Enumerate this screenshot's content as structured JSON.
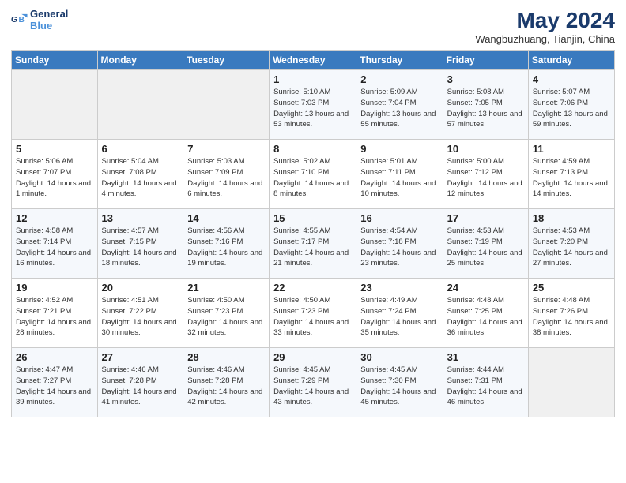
{
  "header": {
    "monthYear": "May 2024",
    "location": "Wangbuzhuang, Tianjin, China"
  },
  "calendar": {
    "headers": [
      "Sunday",
      "Monday",
      "Tuesday",
      "Wednesday",
      "Thursday",
      "Friday",
      "Saturday"
    ],
    "weeks": [
      [
        {
          "day": "",
          "info": ""
        },
        {
          "day": "",
          "info": ""
        },
        {
          "day": "",
          "info": ""
        },
        {
          "day": "1",
          "info": "Sunrise: 5:10 AM\nSunset: 7:03 PM\nDaylight: 13 hours and 53 minutes."
        },
        {
          "day": "2",
          "info": "Sunrise: 5:09 AM\nSunset: 7:04 PM\nDaylight: 13 hours and 55 minutes."
        },
        {
          "day": "3",
          "info": "Sunrise: 5:08 AM\nSunset: 7:05 PM\nDaylight: 13 hours and 57 minutes."
        },
        {
          "day": "4",
          "info": "Sunrise: 5:07 AM\nSunset: 7:06 PM\nDaylight: 13 hours and 59 minutes."
        }
      ],
      [
        {
          "day": "5",
          "info": "Sunrise: 5:06 AM\nSunset: 7:07 PM\nDaylight: 14 hours and 1 minute."
        },
        {
          "day": "6",
          "info": "Sunrise: 5:04 AM\nSunset: 7:08 PM\nDaylight: 14 hours and 4 minutes."
        },
        {
          "day": "7",
          "info": "Sunrise: 5:03 AM\nSunset: 7:09 PM\nDaylight: 14 hours and 6 minutes."
        },
        {
          "day": "8",
          "info": "Sunrise: 5:02 AM\nSunset: 7:10 PM\nDaylight: 14 hours and 8 minutes."
        },
        {
          "day": "9",
          "info": "Sunrise: 5:01 AM\nSunset: 7:11 PM\nDaylight: 14 hours and 10 minutes."
        },
        {
          "day": "10",
          "info": "Sunrise: 5:00 AM\nSunset: 7:12 PM\nDaylight: 14 hours and 12 minutes."
        },
        {
          "day": "11",
          "info": "Sunrise: 4:59 AM\nSunset: 7:13 PM\nDaylight: 14 hours and 14 minutes."
        }
      ],
      [
        {
          "day": "12",
          "info": "Sunrise: 4:58 AM\nSunset: 7:14 PM\nDaylight: 14 hours and 16 minutes."
        },
        {
          "day": "13",
          "info": "Sunrise: 4:57 AM\nSunset: 7:15 PM\nDaylight: 14 hours and 18 minutes."
        },
        {
          "day": "14",
          "info": "Sunrise: 4:56 AM\nSunset: 7:16 PM\nDaylight: 14 hours and 19 minutes."
        },
        {
          "day": "15",
          "info": "Sunrise: 4:55 AM\nSunset: 7:17 PM\nDaylight: 14 hours and 21 minutes."
        },
        {
          "day": "16",
          "info": "Sunrise: 4:54 AM\nSunset: 7:18 PM\nDaylight: 14 hours and 23 minutes."
        },
        {
          "day": "17",
          "info": "Sunrise: 4:53 AM\nSunset: 7:19 PM\nDaylight: 14 hours and 25 minutes."
        },
        {
          "day": "18",
          "info": "Sunrise: 4:53 AM\nSunset: 7:20 PM\nDaylight: 14 hours and 27 minutes."
        }
      ],
      [
        {
          "day": "19",
          "info": "Sunrise: 4:52 AM\nSunset: 7:21 PM\nDaylight: 14 hours and 28 minutes."
        },
        {
          "day": "20",
          "info": "Sunrise: 4:51 AM\nSunset: 7:22 PM\nDaylight: 14 hours and 30 minutes."
        },
        {
          "day": "21",
          "info": "Sunrise: 4:50 AM\nSunset: 7:23 PM\nDaylight: 14 hours and 32 minutes."
        },
        {
          "day": "22",
          "info": "Sunrise: 4:50 AM\nSunset: 7:23 PM\nDaylight: 14 hours and 33 minutes."
        },
        {
          "day": "23",
          "info": "Sunrise: 4:49 AM\nSunset: 7:24 PM\nDaylight: 14 hours and 35 minutes."
        },
        {
          "day": "24",
          "info": "Sunrise: 4:48 AM\nSunset: 7:25 PM\nDaylight: 14 hours and 36 minutes."
        },
        {
          "day": "25",
          "info": "Sunrise: 4:48 AM\nSunset: 7:26 PM\nDaylight: 14 hours and 38 minutes."
        }
      ],
      [
        {
          "day": "26",
          "info": "Sunrise: 4:47 AM\nSunset: 7:27 PM\nDaylight: 14 hours and 39 minutes."
        },
        {
          "day": "27",
          "info": "Sunrise: 4:46 AM\nSunset: 7:28 PM\nDaylight: 14 hours and 41 minutes."
        },
        {
          "day": "28",
          "info": "Sunrise: 4:46 AM\nSunset: 7:28 PM\nDaylight: 14 hours and 42 minutes."
        },
        {
          "day": "29",
          "info": "Sunrise: 4:45 AM\nSunset: 7:29 PM\nDaylight: 14 hours and 43 minutes."
        },
        {
          "day": "30",
          "info": "Sunrise: 4:45 AM\nSunset: 7:30 PM\nDaylight: 14 hours and 45 minutes."
        },
        {
          "day": "31",
          "info": "Sunrise: 4:44 AM\nSunset: 7:31 PM\nDaylight: 14 hours and 46 minutes."
        },
        {
          "day": "",
          "info": ""
        }
      ]
    ]
  }
}
